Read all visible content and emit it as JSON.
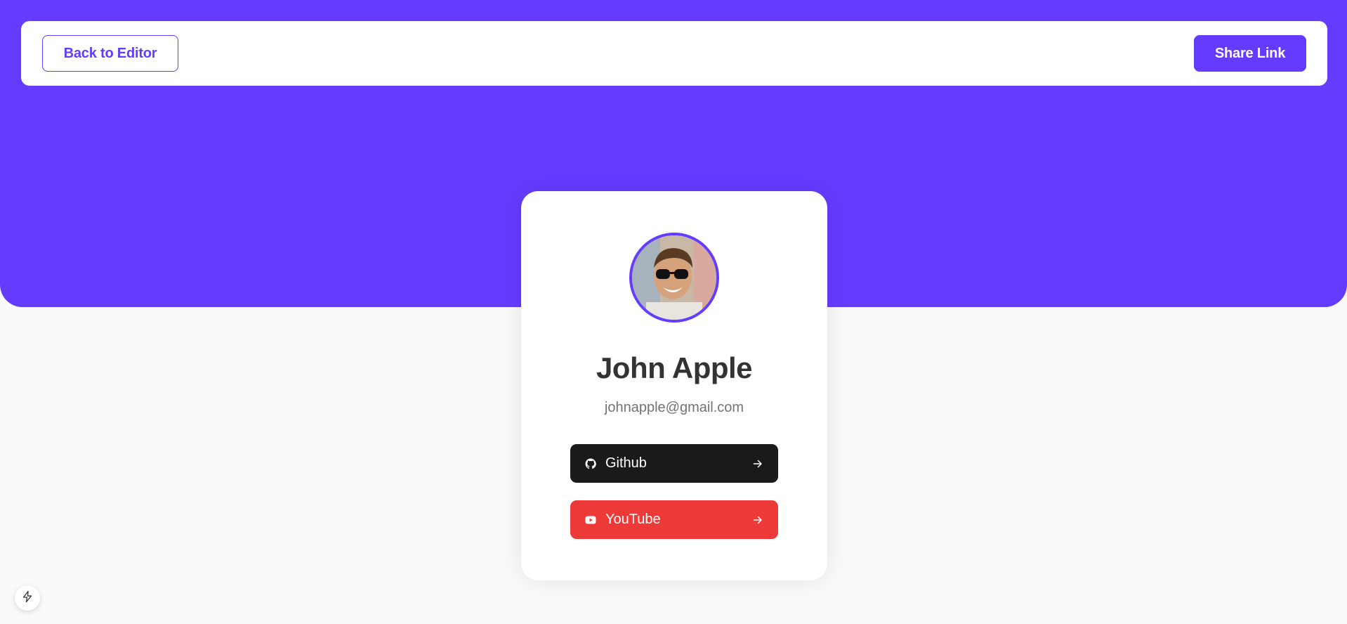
{
  "header": {
    "back_label": "Back to Editor",
    "share_label": "Share Link"
  },
  "profile": {
    "name": "John Apple",
    "email": "johnapple@gmail.com",
    "avatar_alt": "John Apple"
  },
  "links": [
    {
      "platform": "Github",
      "icon": "github-icon",
      "color": "#1A1A1A"
    },
    {
      "platform": "YouTube",
      "icon": "youtube-icon",
      "color": "#EE3939"
    }
  ],
  "colors": {
    "accent": "#633CFF",
    "background": "#FAFAFA",
    "text_dark": "#333333",
    "text_muted": "#737373"
  },
  "devtools": {
    "icon": "lightning-icon"
  }
}
